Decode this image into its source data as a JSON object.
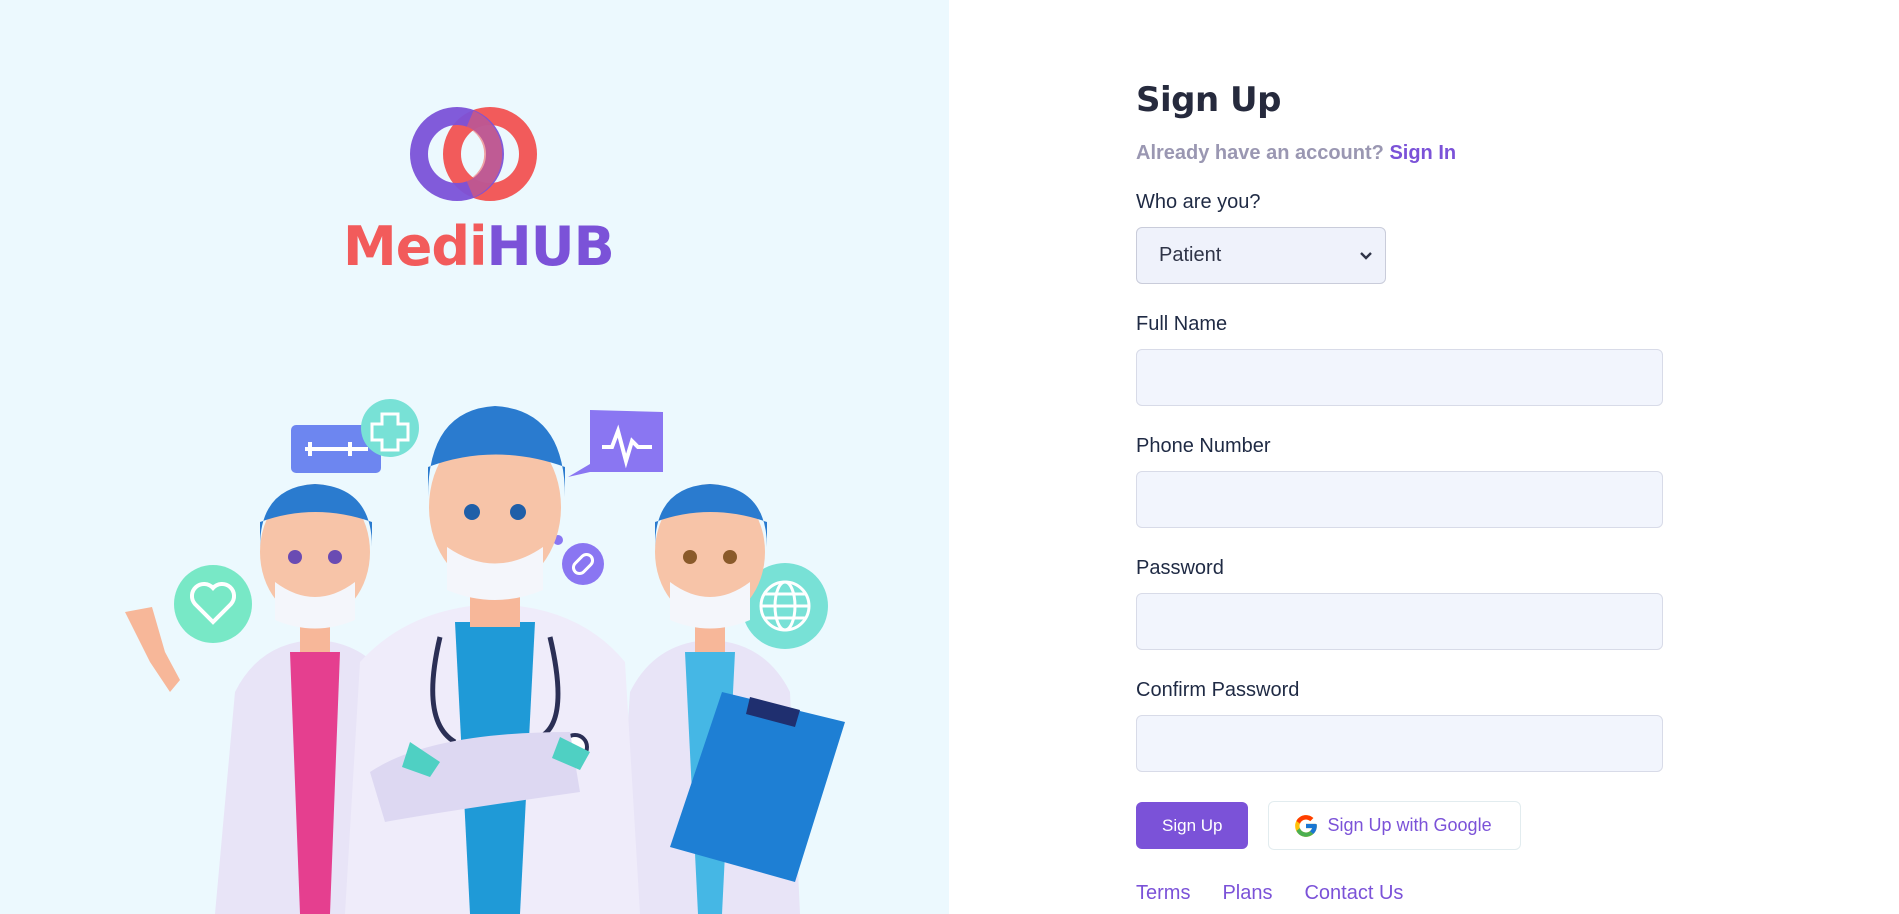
{
  "brand": {
    "name_part1": "Medi",
    "name_part2": "HUB",
    "colors": {
      "coral": "#f25b5b",
      "purple": "#7b52d8"
    }
  },
  "illustration": {
    "icons": [
      "syringe-icon",
      "medical-cross-icon",
      "heartbeat-icon",
      "heart-icon",
      "pill-icon",
      "globe-icon"
    ]
  },
  "form": {
    "title": "Sign Up",
    "account_prompt": "Already have an account?",
    "sign_in_link": "Sign In",
    "role": {
      "label": "Who are you?",
      "selected": "Patient"
    },
    "fields": {
      "full_name": {
        "label": "Full Name",
        "value": ""
      },
      "phone": {
        "label": "Phone Number",
        "value": ""
      },
      "password": {
        "label": "Password",
        "value": ""
      },
      "confirm_password": {
        "label": "Confirm Password",
        "value": ""
      }
    },
    "buttons": {
      "sign_up": "Sign Up",
      "google": "Sign Up with Google"
    }
  },
  "footer": {
    "links": [
      "Terms",
      "Plans",
      "Contact Us"
    ]
  }
}
